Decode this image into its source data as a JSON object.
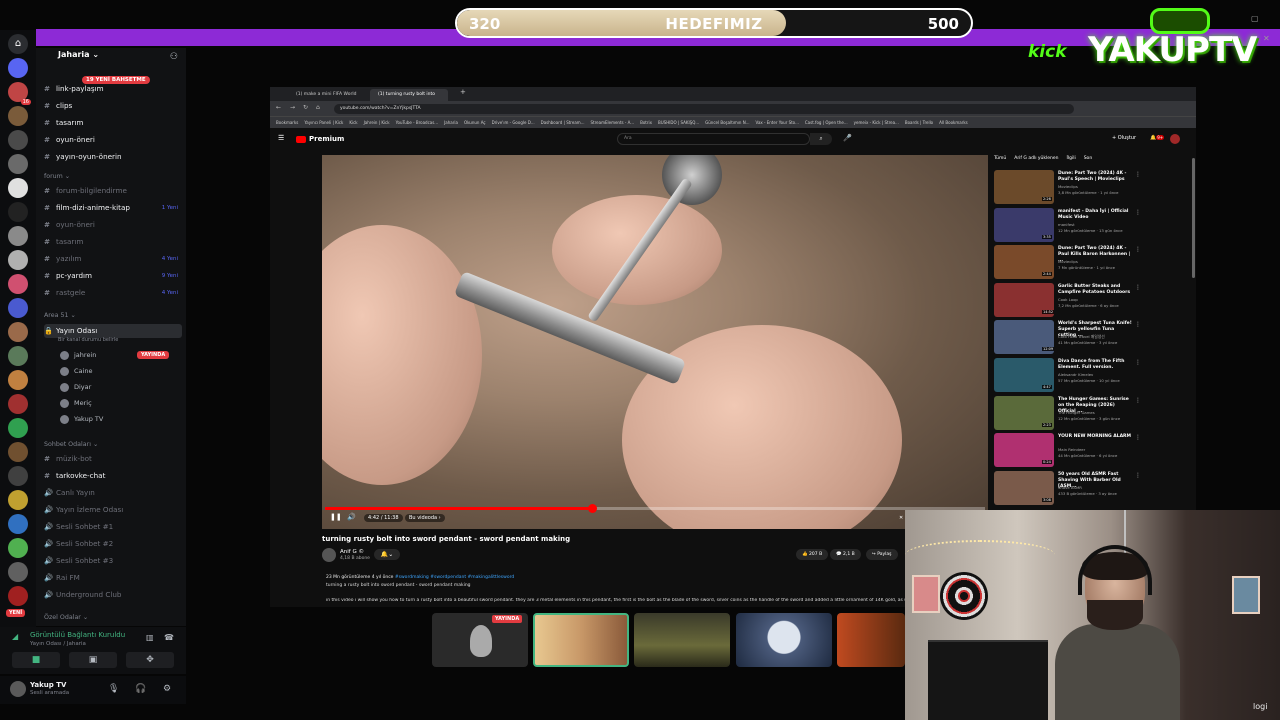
{
  "goal": {
    "start": "320",
    "label": "HEDEFIMIZ",
    "end": "500",
    "progress": 0.64
  },
  "logo": {
    "kick": "kick",
    "name": "YAKUPTV"
  },
  "discord": {
    "server": "Jaharia",
    "new_pill": "19 YENİ BAHSETME",
    "channels_top": [
      {
        "name": "link-paylaşım",
        "style": "bright"
      },
      {
        "name": "clips",
        "style": "bright"
      },
      {
        "name": "tasarım",
        "style": "bright"
      },
      {
        "name": "oyun-öneri",
        "style": "bright"
      },
      {
        "name": "yayın-oyun-önerin",
        "style": "bright"
      }
    ],
    "cat_forum": "forum",
    "channels_forum": [
      {
        "name": "forum-bilgilendirme",
        "style": "dim",
        "count": ""
      },
      {
        "name": "film-dizi-anime-kitap",
        "style": "bright",
        "count": "1 Yeni"
      },
      {
        "name": "oyun-öneri",
        "style": "dim",
        "count": ""
      },
      {
        "name": "tasarım",
        "style": "dim",
        "count": ""
      },
      {
        "name": "yazılım",
        "style": "dim",
        "count": "4 Yeni"
      },
      {
        "name": "pc-yardım",
        "style": "bright",
        "count": "9 Yeni"
      },
      {
        "name": "rastgele",
        "style": "dim",
        "count": "4 Yeni"
      }
    ],
    "cat_area": "Area 51",
    "voice_channel": "Yayın Odası",
    "voice_status": "Bir kanal durumu belirle",
    "live_label": "YAYINDA",
    "voice_users": [
      "jahrein",
      "Caine",
      "Diyar",
      "Meriç",
      "Yakup TV"
    ],
    "cat_chat": "Sohbet Odaları",
    "channels_chat": [
      {
        "name": "müzik-bot",
        "style": "dim"
      },
      {
        "name": "tarkovke-chat",
        "style": "bright"
      },
      {
        "name": "Canlı Yayın",
        "style": "dim"
      },
      {
        "name": "Yayın İzleme Odası",
        "style": "dim"
      },
      {
        "name": "Sesli Sohbet #1",
        "style": "dim"
      },
      {
        "name": "Sesli Sohbet #2",
        "style": "dim"
      },
      {
        "name": "Sesli Sohbet #3",
        "style": "dim"
      },
      {
        "name": "Rai FM",
        "style": "dim"
      },
      {
        "name": "Underground Club",
        "style": "dim"
      }
    ],
    "cat_private": "Özel Odalar",
    "rail_new": "YENİ",
    "voice_panel": {
      "title": "Görüntülü Bağlantı Kuruldu",
      "sub": "Yayın Odası / Jaharia"
    },
    "user": {
      "name": "Yakup TV",
      "status": "Sesli aramada"
    }
  },
  "browser": {
    "tabs": [
      "(1) make a mini FIFA World cup",
      "(1) turning rusty bolt into"
    ],
    "url": "youtube.com/watch?v=ZnYjkpsJTTA",
    "bookmarks": [
      "Bookmarks",
      "Yayıncı Paneli | Kick",
      "Kick",
      "Jahrein | Kick",
      "YouTube - Broadcas...",
      "Jaharia",
      "Okunun Aç",
      "Drive'ım - Google D...",
      "Dashboard | Stream...",
      "StreamElements - A...",
      "Botrix",
      "BUSHIDO | SAKIŞQ...",
      "Güncel Boşaltımın N...",
      "Vax - Enter Your Sto...",
      "Cast.fog | Open the...",
      "yemeix - Kick | Strea...",
      "Boards | Trello",
      "All Bookmarks"
    ],
    "yt_logo": "Premium",
    "search_placeholder": "Ara",
    "create": "Oluştur",
    "notif_count": "9+"
  },
  "video": {
    "time": "4:42 / 11:38",
    "chapter": "Bu videoda",
    "progress": 0.405,
    "title": "turning rusty bolt into sword pendant - sword pendant making",
    "channel": "Anif G ©",
    "subs": "4,18 B abone",
    "likes": "207 B",
    "comments": "2,1 B",
    "share": "Paylaş",
    "meta": "23 Mn görüntüleme  4 yıl önce",
    "tags": "#swordmaking #swordpendant #makingalittlesword",
    "desc1": "turning a rusty bolt into sword pendant - sword pendant making",
    "desc2": "in this video i will show you how to turn a rusty bolt into a beautiful sword pendant. they are 3 metal elements in this pendant, the first is the bolt as the blade of the sword, silver coins as the handle of the sword and added a little ornament of 14K gold, as usual"
  },
  "sidebar": {
    "chips": [
      "Tümü",
      "Arif G adlı yüklenen",
      "İlgili",
      "Son"
    ],
    "recs": [
      {
        "title": "Dune: Part Two (2024) 4K - Paul's Speech | Movieclips",
        "channel": "Movieclips",
        "stats": "3,8 Mn görüntüleme · 1 yıl önce",
        "dur": "2:26",
        "color": "#6b4a2a"
      },
      {
        "title": "manifest - Daha İyi | Official Music Video",
        "channel": "manifest",
        "stats": "12 Mn görüntüleme · 13 gün önce",
        "dur": "3:35",
        "color": "#3a3a6a"
      },
      {
        "title": "Dune: Part Two (2024) 4K - Paul Kills Baron Harkonnen | ...",
        "channel": "Movieclips",
        "stats": "7 Mn görüntüleme · 1 yıl önce",
        "dur": "2:44",
        "color": "#7a4a2a"
      },
      {
        "title": "Garlic Butter Steaks and Campfire Potatoes Outdoors",
        "channel": "Cook Loop",
        "stats": "7,2 Mn görüntüleme · 6 ay önce",
        "dur": "14:52",
        "color": "#8a3030"
      },
      {
        "title": "World's Sharpest Tuna Knife! Superb yellowfin Tuna cutting ...",
        "channel": "Coto Food Travel 매일생선",
        "stats": "41 Mn görüntüleme · 3 yıl önce",
        "dur": "12:09",
        "color": "#4a5a7a"
      },
      {
        "title": "Diva Dance from The Fifth Element. Full version.",
        "channel": "Aleksandr Kimelev",
        "stats": "57 Mn görüntüleme · 10 yıl önce",
        "dur": "4:47",
        "color": "#2a5a6a"
      },
      {
        "title": "The Hunger Games: Sunrise on the Reaping (2026) Official ...",
        "channel": "The Hunger Games",
        "stats": "12 Mn görüntüleme · 3 gün önce",
        "dur": "2:23",
        "color": "#5a6a3a"
      },
      {
        "title": "YOUR NEW MORNING ALARM",
        "channel": "Main Reindeer",
        "stats": "44 Mn görüntüleme · 6 yıl önce",
        "dur": "0:24",
        "color": "#b03070"
      },
      {
        "title": "50 years Old ASMR Fast Shaving With Barber Old [ASM...",
        "channel": "Shave ASMR",
        "stats": "433 B görüntüleme · 3 ay önce",
        "dur": "3:08",
        "color": "#7a5a4a"
      }
    ]
  },
  "stream_tiles": {
    "live_label": "YAYINDA"
  },
  "cam": {
    "brand": "logi"
  }
}
